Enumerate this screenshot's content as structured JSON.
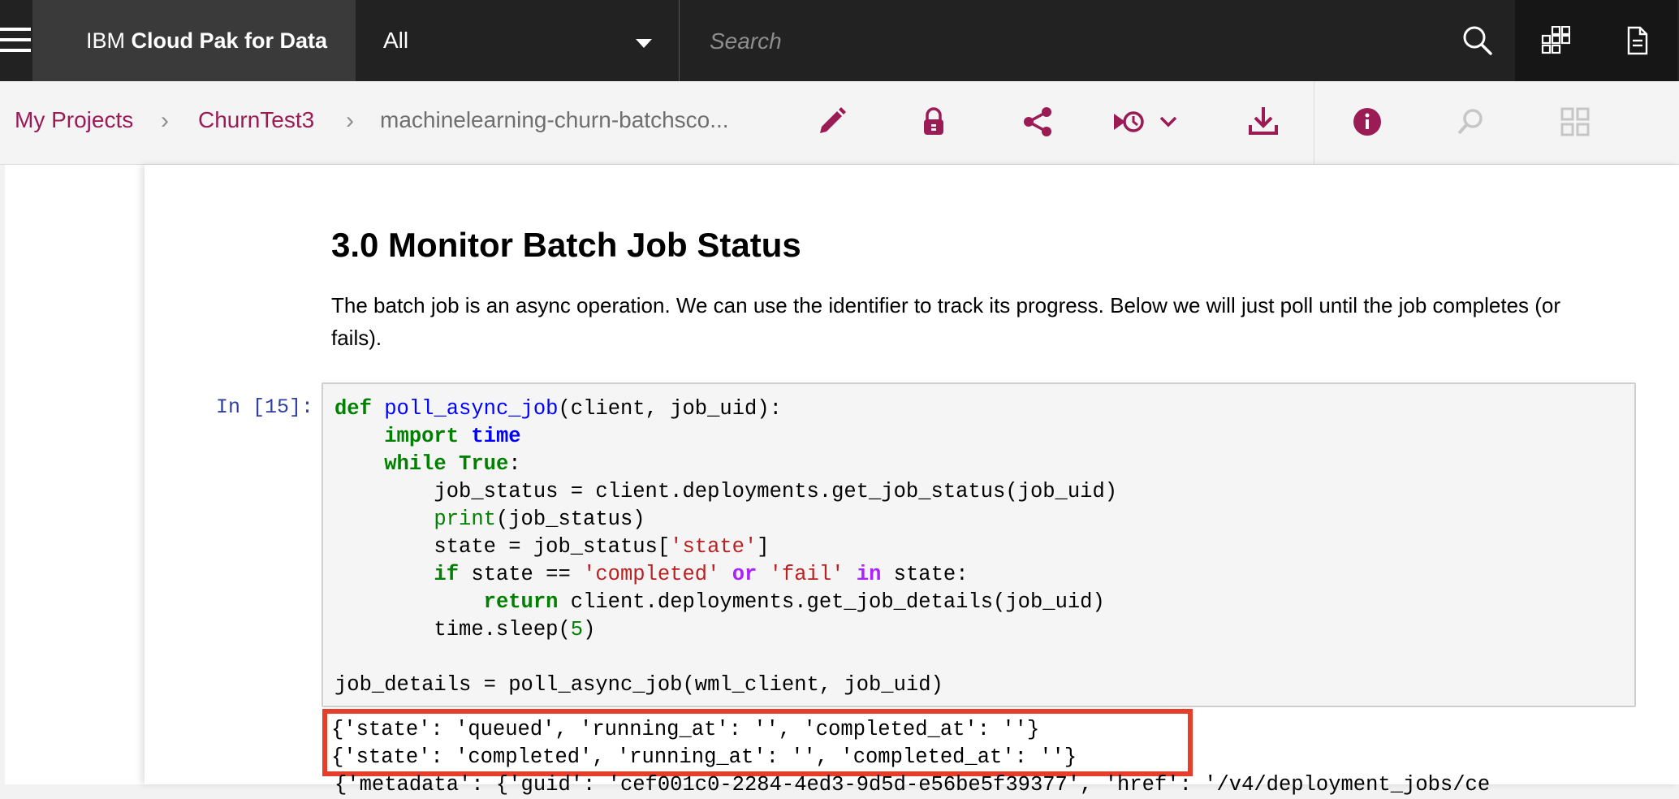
{
  "header": {
    "brand_prefix": "IBM",
    "brand_name": "Cloud Pak for Data",
    "scope_value": "All",
    "search_placeholder": "Search",
    "icons": [
      "menu-icon",
      "search-icon",
      "app-switcher-icon",
      "document-icon"
    ]
  },
  "toolbar": {
    "breadcrumbs": [
      {
        "label": "My Projects"
      },
      {
        "label": "ChurnTest3"
      },
      {
        "label": "machinelearning-churn-batchsco..."
      }
    ],
    "icons": [
      "edit-icon",
      "lock-icon",
      "share-icon",
      "version-history-icon",
      "download-icon",
      "info-icon",
      "find-icon",
      "grid-icon"
    ],
    "accent_color": "#9b1b55"
  },
  "notebook": {
    "heading": "3.0 Monitor Batch Job Status",
    "paragraph": "The batch job is an async operation. We can use the identifier to track its progress. Below we will just poll until the job completes (or fails).",
    "cell_prompt": "In [15]:",
    "code_lines": [
      "def poll_async_job(client, job_uid):",
      "    import time",
      "    while True:",
      "        job_status = client.deployments.get_job_status(job_uid)",
      "        print(job_status)",
      "        state = job_status['state']",
      "        if state == 'completed' or 'fail' in state:",
      "            return client.deployments.get_job_details(job_uid)",
      "        time.sleep(5)",
      "",
      "job_details = poll_async_job(wml_client, job_uid)"
    ],
    "output_lines": [
      "{'state': 'queued', 'running_at': '', 'completed_at': ''}",
      "{'state': 'completed', 'running_at': '', 'completed_at': ''}"
    ],
    "output_cut_line": "{'metadata': {'guid': 'cef001c0-2284-4ed3-9d5d-e56be5f39377', 'href': '/v4/deployment_jobs/ce",
    "highlight_color": "#e53e2b"
  }
}
